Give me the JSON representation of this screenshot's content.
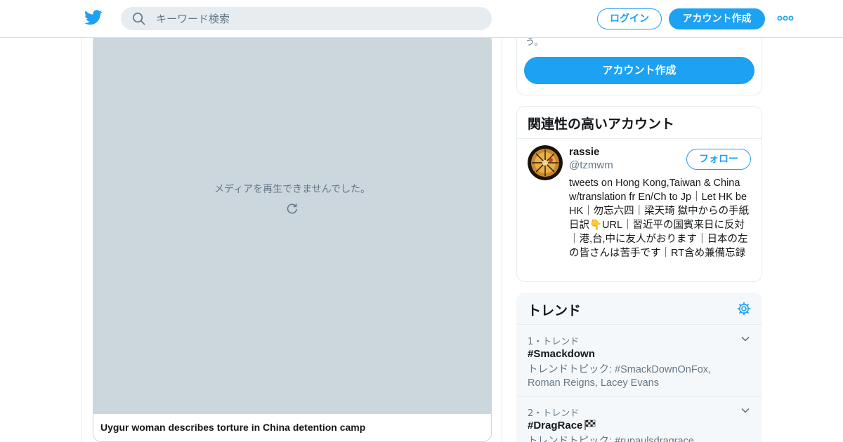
{
  "header": {
    "search_placeholder": "キーワード検索",
    "login_label": "ログイン",
    "signup_label": "アカウント作成",
    "brand_color": "#1da1f2"
  },
  "media": {
    "error_message": "メディアを再生できませんでした。",
    "card_title": "Uygur woman describes torture in China detention camp"
  },
  "signup_panel": {
    "cut_text": "う。",
    "button_label": "アカウント作成"
  },
  "related": {
    "heading": "関連性の高いアカウント",
    "account": {
      "name": "rassie",
      "handle": "@tzmwm",
      "follow_label": "フォロー",
      "bio": "tweets on Hong Kong,Taiwan & China w/translation fr En/Ch to Jp｜Let HK be HK｜勿忘六四｜梁天琦 獄中からの手紙 日訳👇URL｜習近平の国賓来日に反対｜港,台,中に友人がおります｜日本の左の皆さんは苦手です｜RT含め兼備忘録"
    }
  },
  "trends": {
    "heading": "トレンド",
    "items": [
      {
        "meta": "1・トレンド",
        "name": "#Smackdown",
        "desc": "トレンドトピック: #SmackDownOnFox, Roman Reigns, Lacey Evans"
      },
      {
        "meta": "2・トレンド",
        "name": "#DragRace",
        "desc": "トレンドトピック: #rupaulsdragrace"
      }
    ]
  },
  "icons": {
    "logo": "twitter-bird-icon",
    "search": "search-icon",
    "more": "more-icon",
    "reload": "reload-icon",
    "gear": "gear-icon",
    "chevron": "chevron-down-icon",
    "flag": "checkered-flag-icon"
  }
}
